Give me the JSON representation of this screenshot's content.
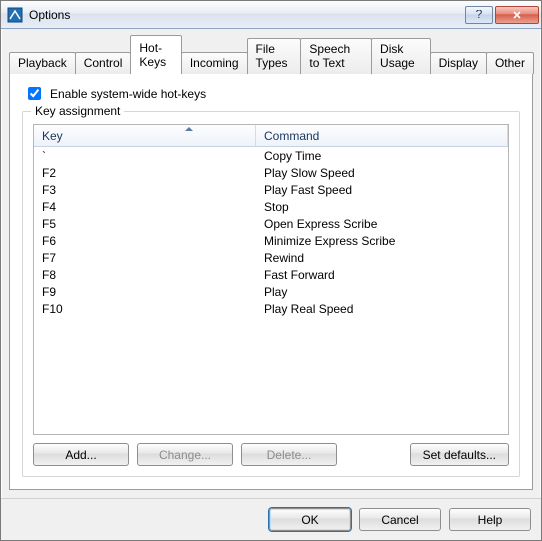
{
  "window": {
    "title": "Options"
  },
  "tabs": [
    {
      "label": "Playback"
    },
    {
      "label": "Control"
    },
    {
      "label": "Hot-Keys"
    },
    {
      "label": "Incoming"
    },
    {
      "label": "File Types"
    },
    {
      "label": "Speech to Text"
    },
    {
      "label": "Disk Usage"
    },
    {
      "label": "Display"
    },
    {
      "label": "Other"
    }
  ],
  "activeTabIndex": 2,
  "hotkeys": {
    "enable_label": "Enable system-wide hot-keys",
    "enable_checked": true,
    "group_legend": "Key assignment",
    "columns": {
      "key": "Key",
      "command": "Command"
    },
    "rows": [
      {
        "key": "`",
        "command": "Copy Time"
      },
      {
        "key": "F2",
        "command": "Play Slow Speed"
      },
      {
        "key": "F3",
        "command": "Play Fast Speed"
      },
      {
        "key": "F4",
        "command": "Stop"
      },
      {
        "key": "F5",
        "command": "Open Express Scribe"
      },
      {
        "key": "F6",
        "command": "Minimize Express Scribe"
      },
      {
        "key": "F7",
        "command": "Rewind"
      },
      {
        "key": "F8",
        "command": "Fast Forward"
      },
      {
        "key": "F9",
        "command": "Play"
      },
      {
        "key": "F10",
        "command": "Play Real Speed"
      }
    ],
    "buttons": {
      "add": "Add...",
      "change": "Change...",
      "delete": "Delete...",
      "defaults": "Set defaults..."
    }
  },
  "footer": {
    "ok": "OK",
    "cancel": "Cancel",
    "help": "Help"
  }
}
